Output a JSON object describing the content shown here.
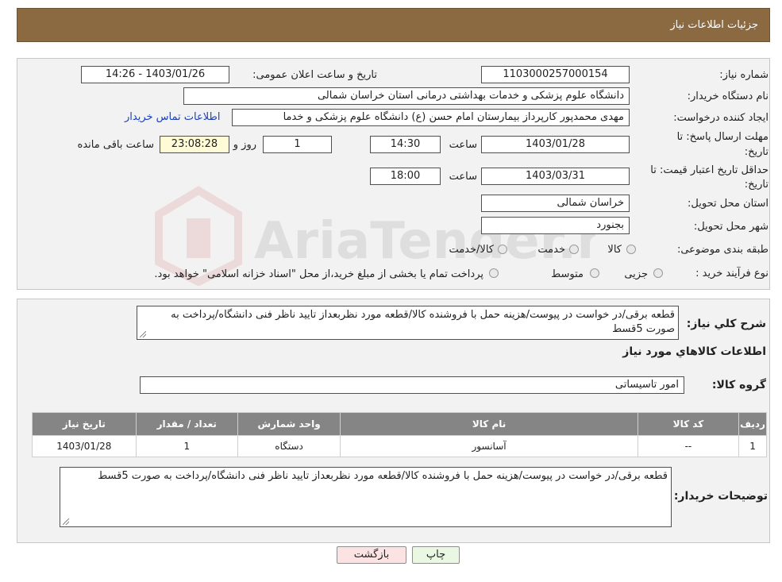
{
  "header": {
    "title": "جزئیات اطلاعات نیاز"
  },
  "form": {
    "need_number_label": "شماره نیاز:",
    "need_number": "1103000257000154",
    "announce_label": "تاریخ و ساعت اعلان عمومی:",
    "announce_value": "1403/01/26 - 14:26",
    "buyer_org_label": "نام دستگاه خریدار:",
    "buyer_org": "دانشگاه علوم پزشکی و خدمات بهداشتی درمانی استان خراسان شمالی",
    "creator_label": "ایجاد کننده درخواست:",
    "creator": "مهدی محمدپور کارپرداز بیمارستان امام حسن (ع) دانشگاه علوم پزشکی و خدما",
    "contact_link": "اطلاعات تماس خریدار",
    "deadline_label_1": "مهلت ارسال پاسخ: تا",
    "deadline_label_2": "تاریخ:",
    "deadline_date": "1403/01/28",
    "time_label": "ساعت",
    "deadline_time": "14:30",
    "days_value": "1",
    "days_label": "روز و",
    "remaining_time": "23:08:28",
    "remaining_label": "ساعت باقی مانده",
    "validity_label_1": "حداقل تاریخ اعتبار قیمت: تا",
    "validity_label_2": "تاریخ:",
    "validity_date": "1403/03/31",
    "validity_time": "18:00",
    "province_label": "استان محل تحویل:",
    "province": "خراسان شمالی",
    "city_label": "شهر محل تحویل:",
    "city": "بجنورد",
    "category_label": "طبقه بندی موضوعی:",
    "category_options": [
      "کالا",
      "خدمت",
      "کالا/خدمت"
    ],
    "process_label": "نوع فرآیند خرید :",
    "process_options": [
      "جزیی",
      "متوسط"
    ],
    "process_note": "پرداخت تمام یا بخشی از مبلغ خرید،از محل \"اسناد خزانه اسلامی\" خواهد بود."
  },
  "details": {
    "summary_label": "شرح کلي نیاز:",
    "summary_text": "قطعه برقی/در خواست در پیوست/هزینه حمل با فروشنده کالا/قطعه مورد نظربعداز تایید ناظر فنی دانشگاه/پرداخت به صورت 5قسط",
    "items_title": "اطلاعات کالاهاي مورد نياز",
    "group_label": "گروه کالا:",
    "group_value": "امور تاسیساتی",
    "table_headers": [
      "ردیف",
      "کد کالا",
      "نام کالا",
      "واحد شمارش",
      "تعداد / مقدار",
      "تاریخ نیاز"
    ],
    "table_rows": [
      [
        "1",
        "--",
        "آسانسور",
        "دستگاه",
        "1",
        "1403/01/28"
      ]
    ],
    "buyer_notes_label": "توضیحات خریدار:",
    "buyer_notes": "قطعه برقی/در خواست در پیوست/هزینه حمل با فروشنده کالا/قطعه مورد نظربعداز تایید ناظر فنی دانشگاه/پرداخت به صورت 5قسط"
  },
  "buttons": {
    "print": "چاپ",
    "back": "بازگشت"
  },
  "watermark": {
    "text": "AriaTender.neT"
  }
}
